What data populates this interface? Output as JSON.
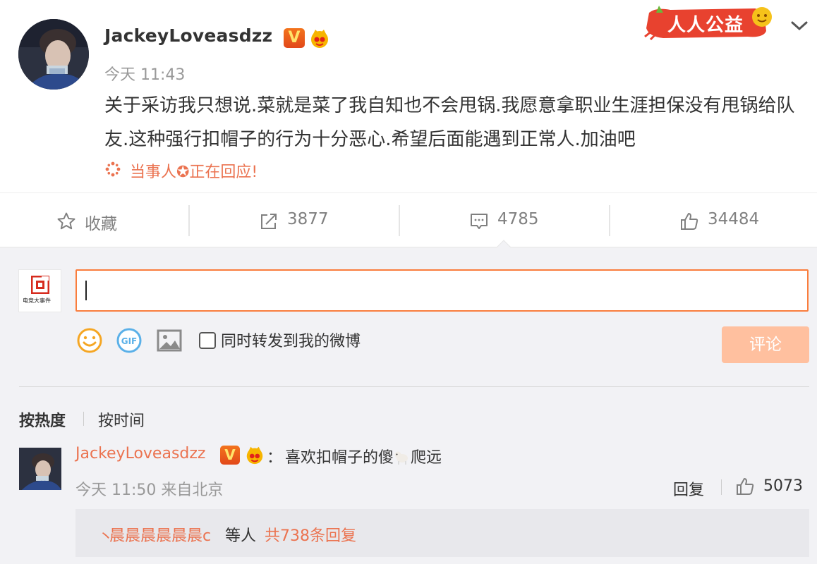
{
  "post": {
    "username": "JackeyLoveasdzz",
    "verified_badge": "V",
    "time": "今天 11:43",
    "content": "关于采访我只想说.菜就是菜了我自知也不会甩锅.我愿意拿职业生涯担保没有甩锅给队友.这种强行扣帽子的行为十分恶心.希望后面能遇到正常人.加油吧",
    "hot_topic": "当事人✪正在回应!",
    "charity_label": "人人公益",
    "menu_icon": "chevron-down-icon"
  },
  "actions": {
    "favorite": "收藏",
    "repost": "3877",
    "comment": "4785",
    "like": "34484"
  },
  "composer": {
    "avatar_caption": "电竞大事件",
    "input_value": "",
    "sync_label": "同时转发到我的微博",
    "sync_checked": false,
    "submit_label": "评论",
    "tools": [
      "emoji-icon",
      "gif-icon",
      "image-icon"
    ]
  },
  "sort": {
    "by_hot": "按热度",
    "by_time": "按时间"
  },
  "comments": [
    {
      "username": "JackeyLoveasdzz",
      "verified_badge": "V",
      "colon": "：",
      "text_before": "喜欢扣帽子的傻",
      "text_after": "爬远",
      "meta": "今天 11:50 来自北京",
      "reply_label": "回复",
      "likes": "5073",
      "replies": {
        "slash": "丶",
        "who": "晨晨晨晨晨晨c",
        "etc": "等人",
        "count": "共738条回复"
      }
    }
  ],
  "colors": {
    "accent": "#fa7d3c",
    "link": "#eb7350",
    "muted": "#999999",
    "submit_disabled": "#ffc09f"
  }
}
